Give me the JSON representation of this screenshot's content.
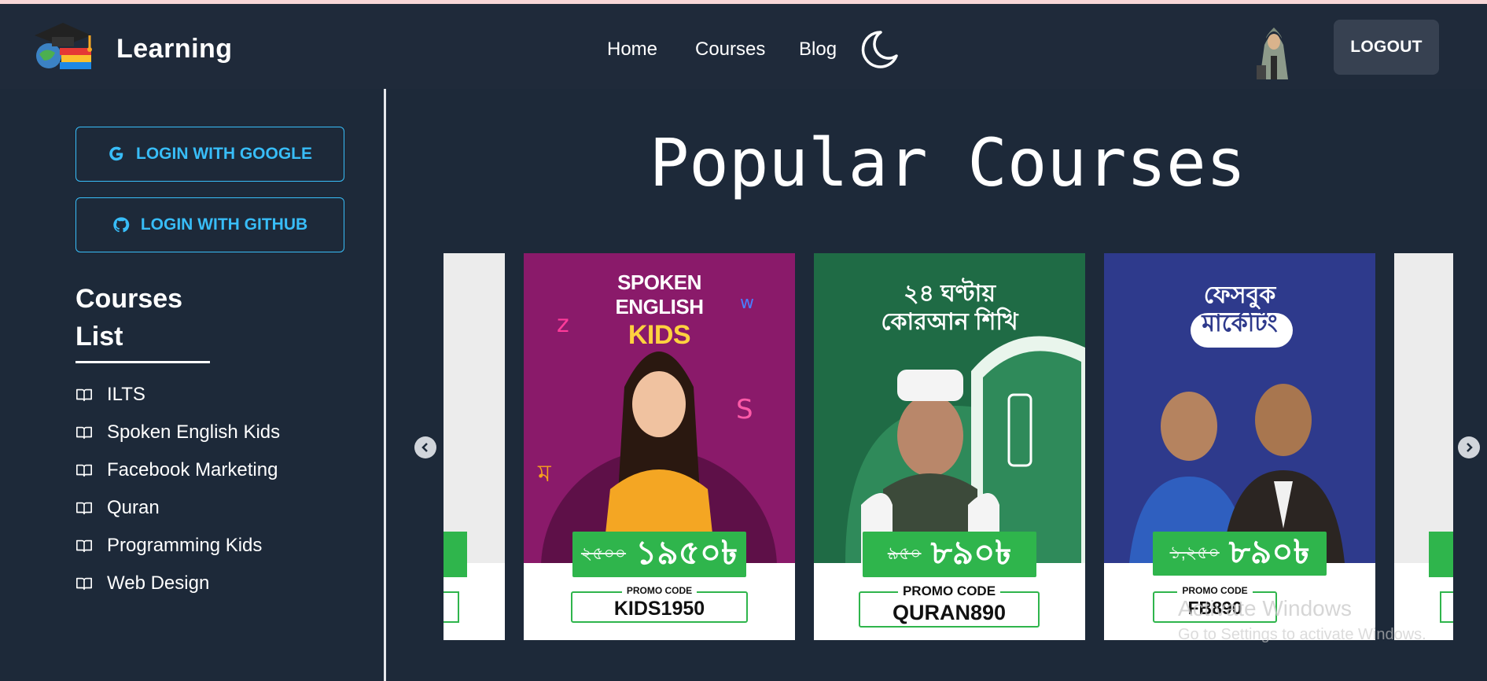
{
  "nav": {
    "brand": "Learning",
    "links": [
      "Home",
      "Courses",
      "Blog"
    ],
    "theme_toggle_icon": "moon-icon",
    "logout": "LOGOUT"
  },
  "sidebar": {
    "login_google": "LOGIN WITH GOOGLE",
    "login_github": "LOGIN WITH GITHUB",
    "heading_line1": "Courses",
    "heading_line2": "List",
    "items": [
      "ILTS",
      "Spoken English Kids",
      "Facebook Marketing",
      "Quran",
      "Programming Kids",
      "Web Design"
    ]
  },
  "main": {
    "title": "Popular Courses",
    "cards": [
      {
        "title_l1": "SPOKEN",
        "title_l2": "ENGLISH",
        "title_l3": "KIDS",
        "old_price": "২৫০০",
        "new_price": "১৯৫০৳",
        "promo_label": "PROMO CODE",
        "promo_code": "KIDS1950",
        "bg": "#8a1a6a"
      },
      {
        "title_l1": "২৪ ঘণ্টায়",
        "title_l2": "কোরআন শিখি",
        "old_price": "৯৫০",
        "new_price": "৮৯০৳",
        "promo_label": "PROMO CODE",
        "promo_code": "QURAN890",
        "bg": "#1f6b45"
      },
      {
        "title_l1": "ফেসবুক",
        "title_l2": "মার্কেটিং",
        "old_price": "১,২৫০",
        "new_price": "৮৯০৳",
        "promo_label": "PROMO CODE",
        "promo_code": "FB890",
        "bg": "#2e3a8c"
      }
    ]
  },
  "watermark": {
    "line1": "Activate Windows",
    "line2": "Go to Settings to activate Windows."
  }
}
